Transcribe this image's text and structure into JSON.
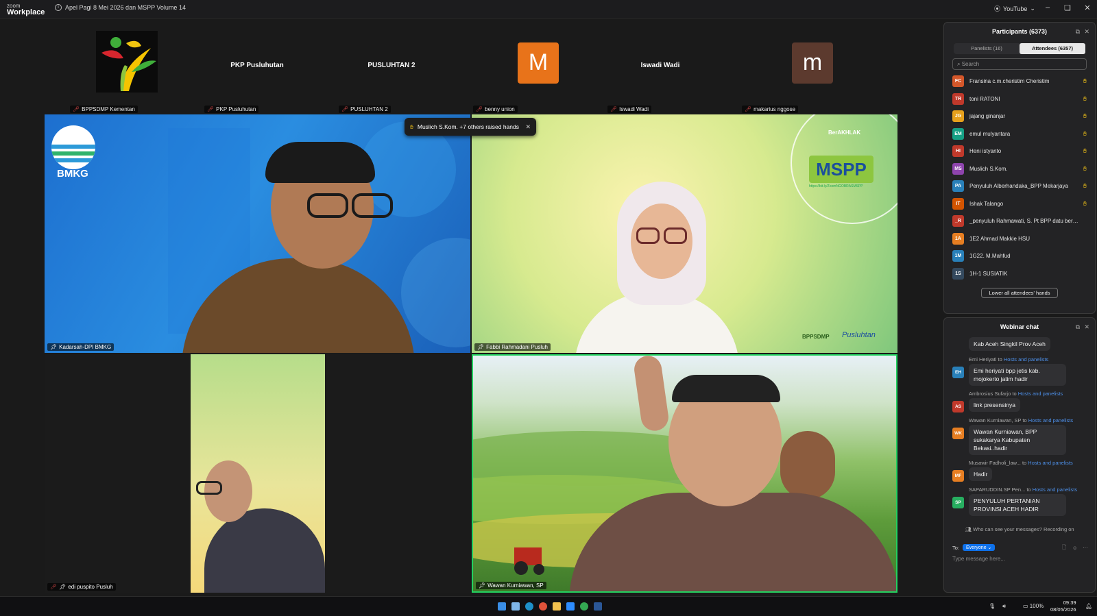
{
  "app": {
    "logo_top": "zoom",
    "logo_bottom": "Workplace",
    "meeting_title": "Apel Pagi 8 Mei 2026 dan MSPP Volume 14",
    "stream": "YouTube"
  },
  "thumbnails": [
    {
      "center": "",
      "label": "BPPSDMP Kementan"
    },
    {
      "center": "PKP Pusluhutan",
      "label": "PKP Pusluhutan"
    },
    {
      "center": "PUSLUHTAN 2",
      "label": "PUSLUHTAN 2"
    },
    {
      "center": "",
      "avatar": "M",
      "label": "benny union",
      "color": "#e8731a"
    },
    {
      "center": "Iswadi Wadi",
      "label": "Iswadi Wadi"
    },
    {
      "center": "",
      "avatar": "m",
      "label": "makarius nggose",
      "color": "#5c3a2e"
    }
  ],
  "video_tiles": {
    "tl": {
      "label": "Kadarsah-DPI BMKG",
      "logo_text": "BMKG"
    },
    "tr": {
      "label": "Fabbi Rahmadani Pusluh",
      "brand1": "BerAKHLAK",
      "brand2": "MSPP",
      "brand3": "BPPSDMP",
      "brand4": "Pusluhtan",
      "url": "https://bit.ly/ZoomNGOBRASMSPP"
    },
    "bl": {
      "label": "edi puspito Pusluh"
    },
    "br": {
      "label": "Wawan Kurniawan, SP"
    }
  },
  "raise_toast": {
    "text": "Muslich S.Kom. +7 others raised hands"
  },
  "participants": {
    "title": "Participants (6373)",
    "tabs": [
      "Panelists (16)",
      "Attendees (6357)"
    ],
    "search_placeholder": "Search",
    "rows": [
      {
        "initials": "FC",
        "name": "Fransina c.m.cheristim Cheristim",
        "color": "#d4572a",
        "hand": true
      },
      {
        "initials": "TR",
        "name": "toni RATONI",
        "color": "#c0392b",
        "hand": true
      },
      {
        "initials": "JG",
        "name": "jajang ginanjar",
        "color": "#e6a01c",
        "hand": true
      },
      {
        "initials": "EM",
        "name": "emul mulyantara",
        "color": "#16a085",
        "hand": true
      },
      {
        "initials": "HI",
        "name": "Heni istyanto",
        "color": "#c0392b",
        "hand": true
      },
      {
        "initials": "MS",
        "name": "Muslich S.Kom.",
        "color": "#8e44ad",
        "hand": true
      },
      {
        "initials": "PA",
        "name": "Penyuluh Alberhandaka_BPP Mekarjaya",
        "color": "#2980b9",
        "hand": true
      },
      {
        "initials": "IT",
        "name": "Ishak Talango",
        "color": "#d35400",
        "hand": true
      },
      {
        "initials": "_R",
        "name": "_penyuluh Rahmawati, S. Pt BPP datu beru...",
        "color": "#c0392b",
        "hand": false
      },
      {
        "initials": "1A",
        "name": "1E2 Ahmad Makkie HSU",
        "color": "#e67e22",
        "hand": false
      },
      {
        "initials": "1M",
        "name": "1G22. M.Mahfud",
        "color": "#2980b9",
        "hand": false
      },
      {
        "initials": "1S",
        "name": "1H-1 SUSIATIK",
        "color": "#34495e",
        "hand": false
      }
    ],
    "lower_hands": "Lower all attendees' hands"
  },
  "chat": {
    "title": "Webinar chat",
    "messages": [
      {
        "meta": "",
        "to": "",
        "initials": "",
        "color": "#16a085",
        "text": "Kab Aceh Singkil Prov Aceh"
      },
      {
        "meta": "Emi Heriyati to",
        "to": "Hosts and panelists",
        "initials": "EH",
        "color": "#2980b9",
        "text": "Emi heriyati bpp jetis kab. mojokerto jatim hadir"
      },
      {
        "meta": "Ambrosius Sufarjo to",
        "to": "Hosts and panelists",
        "initials": "AS",
        "color": "#c0392b",
        "text": "link presensinya"
      },
      {
        "meta": "Wawan Kurniawan, SP to",
        "to": "Hosts and panelists",
        "initials": "WK",
        "color": "#e67e22",
        "text": "Wawan Kurniawan, BPP sukakarya Kabupaten Bekasi..hadir"
      },
      {
        "meta": "Musawir Fadholi_law... to",
        "to": "Hosts and panelists",
        "initials": "MF",
        "color": "#e67e22",
        "text": "Hadir"
      },
      {
        "meta": "SAPARUDDIN.SP Pen... to",
        "to": "Hosts and panelists",
        "initials": "SP",
        "color": "#27ae60",
        "text": "PENYULUH PERTANIAN PROVINSI ACEH HADIR"
      }
    ],
    "privacy_note": "Who can see your messages? Recording on",
    "to_label": "To:",
    "to_value": "Everyone",
    "input_placeholder": "Type message here..."
  },
  "taskbar": {
    "time": "09:39",
    "date": "08/05/2026",
    "battery": "100%"
  }
}
